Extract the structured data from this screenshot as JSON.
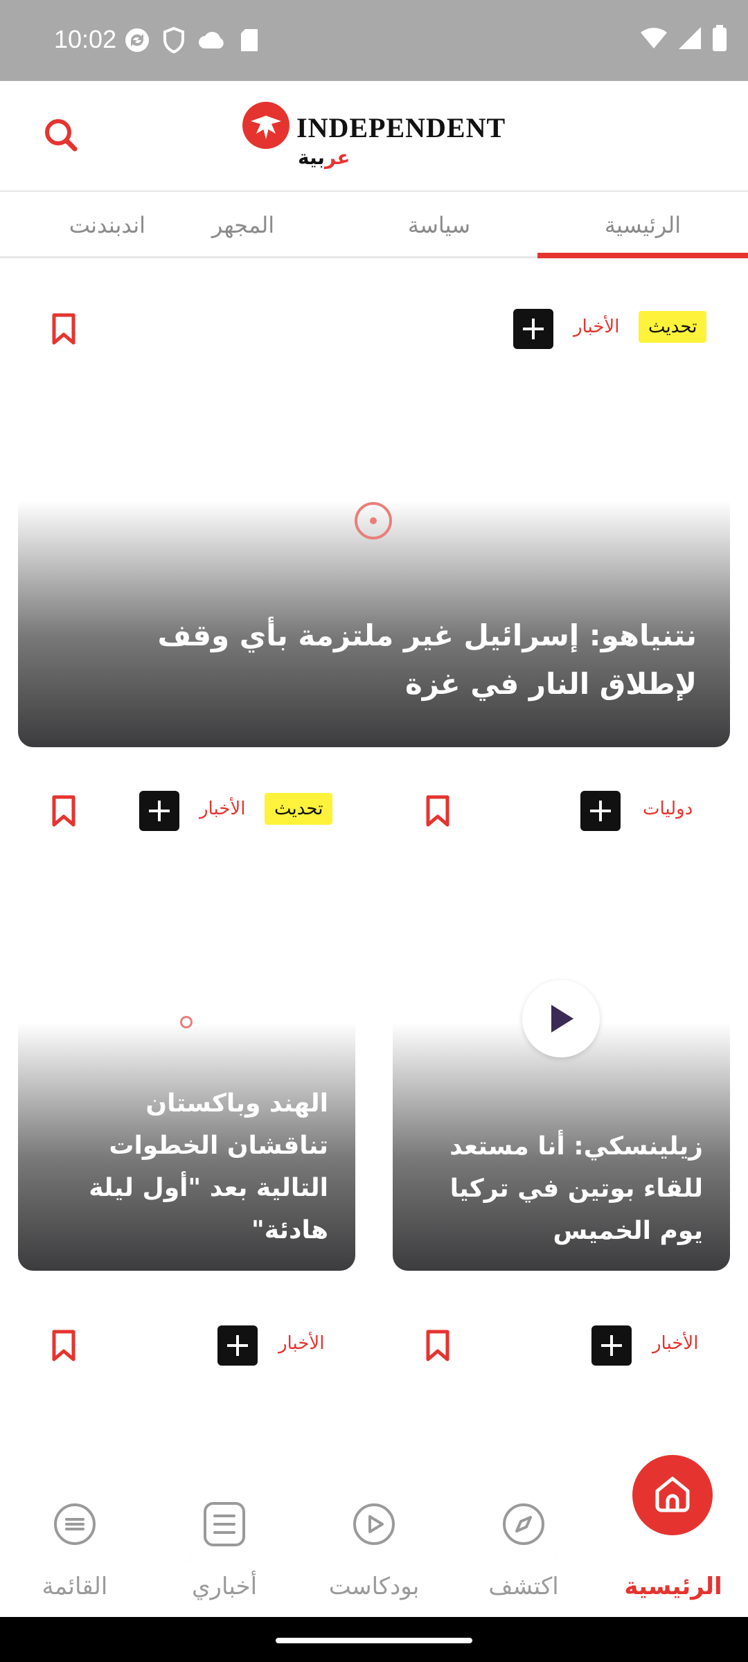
{
  "status_bar": {
    "time": "10:02",
    "left_icons": [
      "sync-icon",
      "shield-icon",
      "cloud-icon",
      "sd-card-icon"
    ],
    "right_icons": [
      "wifi-icon",
      "signal-icon",
      "battery-icon"
    ]
  },
  "header": {
    "logo_text": "INDEPENDENT",
    "logo_arabic": "عربية",
    "search_icon": "search-icon"
  },
  "tabs": [
    {
      "label": "الرئيسية",
      "active": true
    },
    {
      "label": "سياسة",
      "active": false
    },
    {
      "label": "المجهر",
      "active": false
    },
    {
      "label": "اندبندنت",
      "active": false
    }
  ],
  "colors": {
    "accent": "#e5342f",
    "badge": "#fff23a",
    "status_bar": "#a9a9a9"
  },
  "articles": [
    {
      "category": "الأخبار",
      "badge": "تحديث",
      "title": "نتنياهو: إسرائيل غير ملتزمة بأي وقف لإطلاق النار في غزة",
      "media": "loading"
    },
    {
      "category": "دوليات",
      "badge": "",
      "title": "زيلينسكي: أنا مستعد للقاء بوتين في تركيا يوم الخميس",
      "media": "video"
    },
    {
      "category": "الأخبار",
      "badge": "تحديث",
      "title": "الهند وباكستان تناقشان الخطوات التالية بعد \"أول ليلة هادئة\"",
      "media": "loading"
    },
    {
      "category": "الأخبار",
      "badge": "",
      "title": "",
      "media": "loading"
    },
    {
      "category": "الأخبار",
      "badge": "",
      "title": "",
      "media": "loading"
    }
  ],
  "bottom_nav": [
    {
      "label": "الرئيسية",
      "icon": "home-icon",
      "active": true
    },
    {
      "label": "اكتشف",
      "icon": "compass-icon",
      "active": false
    },
    {
      "label": "بودكاست",
      "icon": "play-circle-icon",
      "active": false
    },
    {
      "label": "أخباري",
      "icon": "document-icon",
      "active": false
    },
    {
      "label": "القائمة",
      "icon": "menu-icon",
      "active": false
    }
  ]
}
